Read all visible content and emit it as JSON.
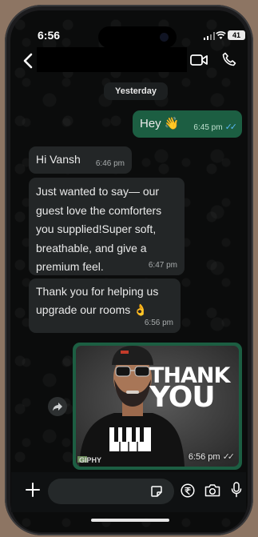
{
  "status_bar": {
    "time": "6:56",
    "battery": "41"
  },
  "date_separator": "Yesterday",
  "messages": [
    {
      "direction": "outgoing",
      "text": "Hey 👋",
      "time": "6:45 pm"
    },
    {
      "direction": "incoming",
      "text": "Hi Vansh",
      "time": "6:46 pm"
    },
    {
      "direction": "incoming",
      "text": "Just wanted to say— our guest love the comforters you supplied!Super soft, breathable, and give a premium feel.",
      "time": "6:47 pm"
    },
    {
      "direction": "incoming",
      "text": "Thank you for helping us upgrade our rooms 👌",
      "time": "6:56 pm"
    },
    {
      "direction": "outgoing",
      "type": "gif",
      "gif_text_1": "THANK",
      "gif_text_2": "YOU",
      "gif_source": "GIPHY",
      "time": "6:56 pm"
    }
  ],
  "icons": {
    "header": [
      "back-icon",
      "video-call-icon",
      "phone-icon"
    ],
    "composer": [
      "plus-icon",
      "sticker-icon",
      "rupee-payment-icon",
      "camera-icon",
      "microphone-icon"
    ]
  },
  "colors": {
    "outgoing_bubble": "#1c5e42",
    "incoming_bubble": "#232627",
    "read_ticks": "#58b7f5"
  }
}
